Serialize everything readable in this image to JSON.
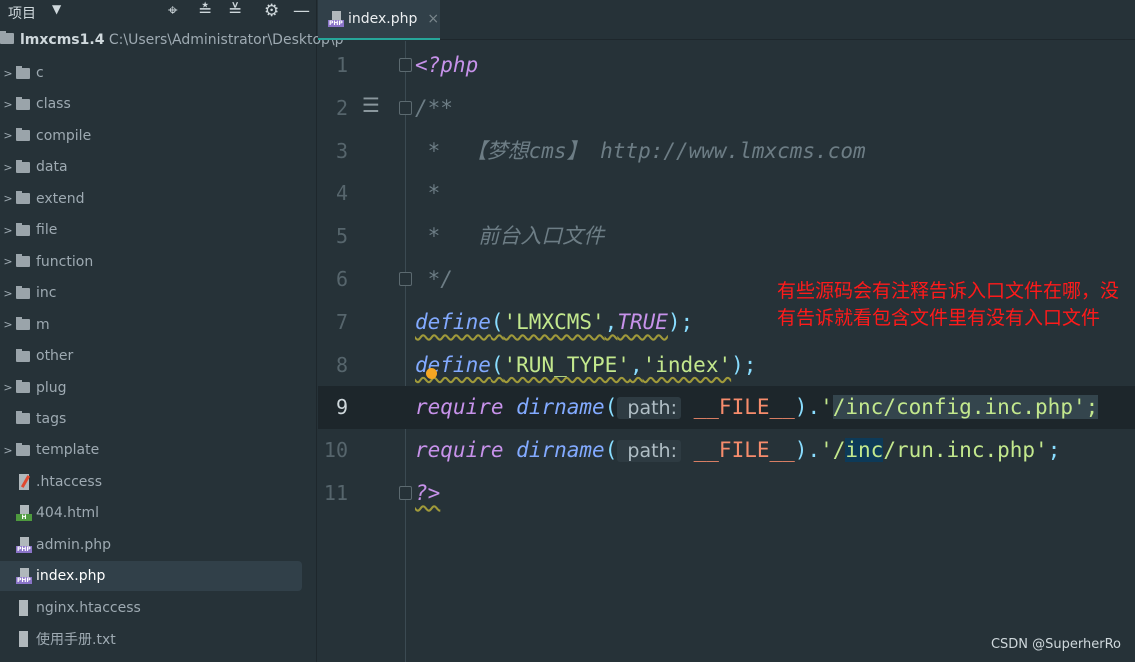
{
  "sidebar": {
    "title": "项目",
    "root_name": "lmxcms1.4",
    "root_path": "C:\\Users\\Administrator\\Desktop\\p",
    "items": [
      {
        "label": "c",
        "type": "folder",
        "expandable": true
      },
      {
        "label": "class",
        "type": "folder",
        "expandable": true
      },
      {
        "label": "compile",
        "type": "folder",
        "expandable": true
      },
      {
        "label": "data",
        "type": "folder",
        "expandable": true
      },
      {
        "label": "extend",
        "type": "folder",
        "expandable": true
      },
      {
        "label": "file",
        "type": "folder",
        "expandable": true
      },
      {
        "label": "function",
        "type": "folder",
        "expandable": true
      },
      {
        "label": "inc",
        "type": "folder",
        "expandable": true
      },
      {
        "label": "m",
        "type": "folder",
        "expandable": true
      },
      {
        "label": "other",
        "type": "folder",
        "expandable": false
      },
      {
        "label": "plug",
        "type": "folder",
        "expandable": true
      },
      {
        "label": "tags",
        "type": "folder",
        "expandable": false
      },
      {
        "label": "template",
        "type": "folder",
        "expandable": true
      },
      {
        "label": ".htaccess",
        "type": "ht"
      },
      {
        "label": "404.html",
        "type": "html"
      },
      {
        "label": "admin.php",
        "type": "php"
      },
      {
        "label": "index.php",
        "type": "php",
        "selected": true
      },
      {
        "label": "nginx.htaccess",
        "type": "txt"
      },
      {
        "label": "使用手册.txt",
        "type": "txt"
      }
    ]
  },
  "tab": {
    "label": "index.php",
    "close": "×"
  },
  "editor": {
    "current_line": 9,
    "lines": [
      [
        {
          "t": "<?php",
          "c": "pl"
        }
      ],
      [
        {
          "t": "/**",
          "c": "c"
        }
      ],
      [
        {
          "t": " *  【梦想cms】 http://www.lmxcms.com",
          "c": "c"
        }
      ],
      [
        {
          "t": " *",
          "c": "c"
        }
      ],
      [
        {
          "t": " *   前台入口文件",
          "c": "c"
        }
      ],
      [
        {
          "t": " */",
          "c": "c"
        }
      ],
      [
        {
          "t": "define",
          "c": "f wavy"
        },
        {
          "t": "(",
          "c": "p wavy"
        },
        {
          "t": "'LMXCMS'",
          "c": "s wavy"
        },
        {
          "t": ",",
          "c": "p wavy"
        },
        {
          "t": "TRUE",
          "c": "k wavy"
        },
        {
          "t": ");",
          "c": "p"
        }
      ],
      [
        {
          "t": "define",
          "c": "f wavy"
        },
        {
          "t": "(",
          "c": "p wavy"
        },
        {
          "t": "'RUN_TYPE'",
          "c": "s wavy"
        },
        {
          "t": ",",
          "c": "p wavy"
        },
        {
          "t": "'index'",
          "c": "s wavy"
        },
        {
          "t": ");",
          "c": "p"
        }
      ],
      [
        {
          "t": "require",
          "c": "k"
        },
        {
          "t": " "
        },
        {
          "t": "dirname",
          "c": "f"
        },
        {
          "t": "(",
          "c": "p"
        },
        {
          "t": " path:",
          "c": "hint"
        },
        {
          "t": " "
        },
        {
          "t": "__FILE__",
          "c": "cst"
        },
        {
          "t": ").",
          "c": "p"
        },
        {
          "t": "'",
          "c": "s"
        },
        {
          "t": "/inc/config.inc.php';",
          "c": "s sel1"
        }
      ],
      [
        {
          "t": "require",
          "c": "k"
        },
        {
          "t": " "
        },
        {
          "t": "dirname",
          "c": "f"
        },
        {
          "t": "(",
          "c": "p"
        },
        {
          "t": " path:",
          "c": "hint"
        },
        {
          "t": " "
        },
        {
          "t": "__FILE__",
          "c": "cst"
        },
        {
          "t": ").",
          "c": "p"
        },
        {
          "t": "'/",
          "c": "s"
        },
        {
          "t": "inc",
          "c": "s sel2"
        },
        {
          "t": "/run.inc.php'",
          "c": "s"
        },
        {
          "t": ";",
          "c": "p"
        }
      ],
      [
        {
          "t": "?>",
          "c": "pl wavy"
        }
      ]
    ]
  },
  "annotation": "有些源码会有注释告诉入口文件在哪，没有告诉就看包含文件里有没有入口文件",
  "watermark": "CSDN @SuperherRo"
}
